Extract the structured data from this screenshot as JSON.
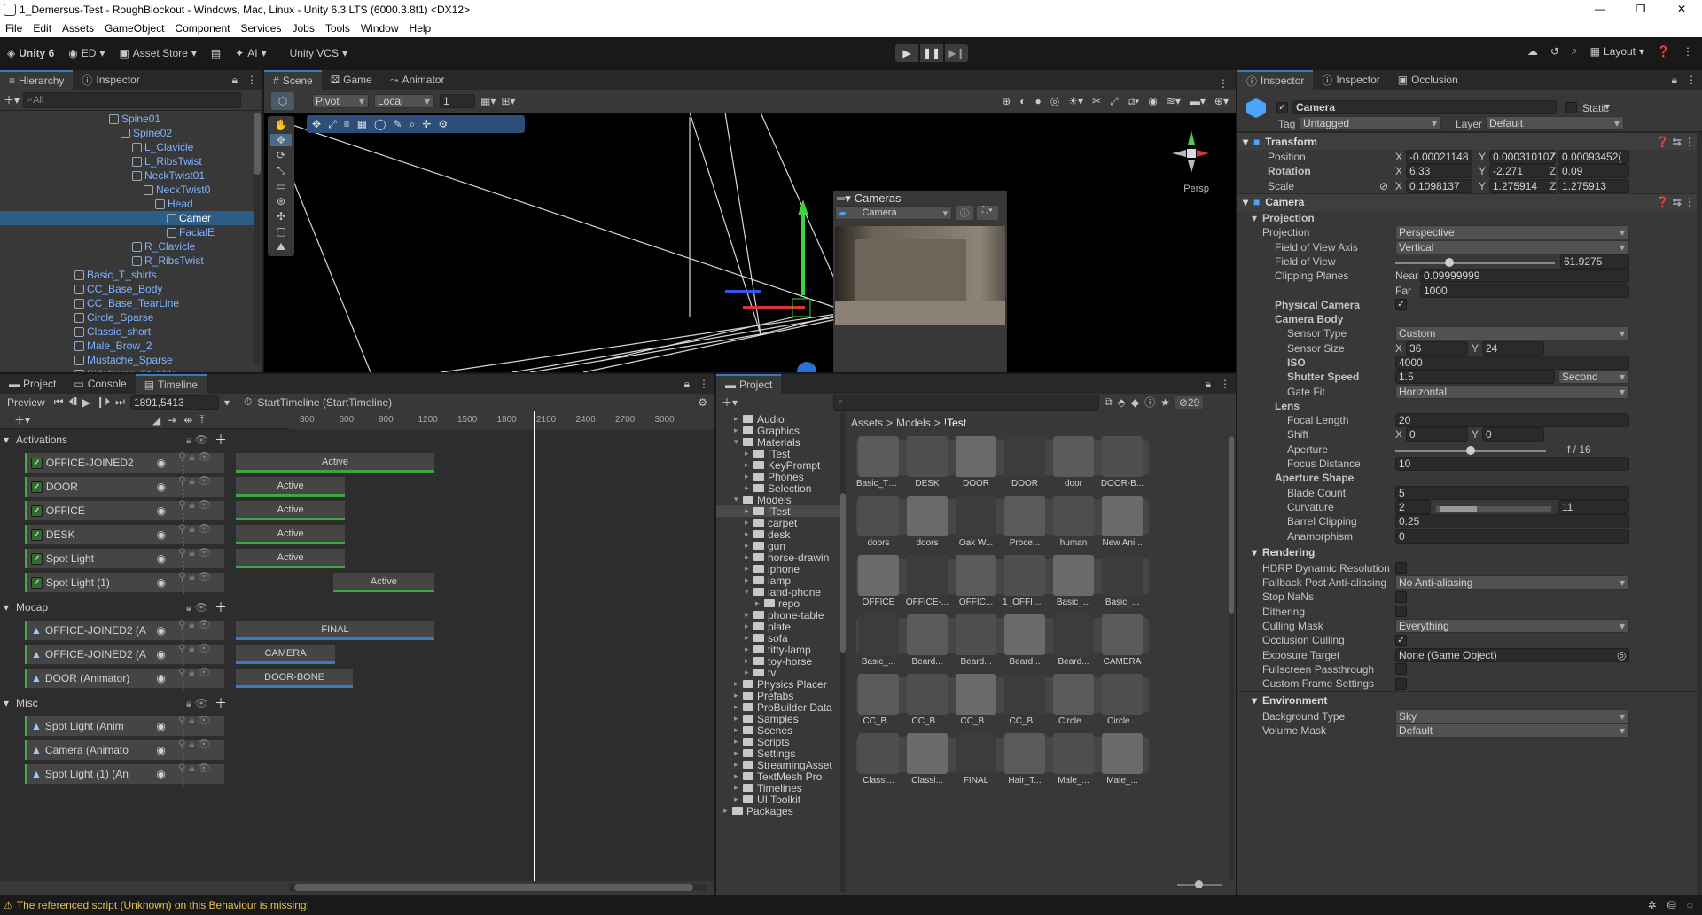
{
  "window": {
    "title": "1_Demersus-Test - RoughBlockout - Windows, Mac, Linux - Unity 6.3 LTS (6000.3.8f1) <DX12>"
  },
  "menu": [
    "File",
    "Edit",
    "Assets",
    "GameObject",
    "Component",
    "Services",
    "Jobs",
    "Tools",
    "Window",
    "Help"
  ],
  "toolbar": {
    "unity": "Unity 6",
    "account": "ED",
    "asset_store": "Asset Store",
    "ai": "AI",
    "vcs": "Unity VCS",
    "layout": "Layout"
  },
  "hierarchy": {
    "tabs": [
      "Hierarchy",
      "Inspector"
    ],
    "search_placeholder": "All",
    "rows": [
      {
        "label": "Spine01",
        "indent": 9
      },
      {
        "label": "Spine02",
        "indent": 10
      },
      {
        "label": "L_Clavicle",
        "indent": 11
      },
      {
        "label": "L_RibsTwist",
        "indent": 11
      },
      {
        "label": "NeckTwist01",
        "indent": 11
      },
      {
        "label": "NeckTwist0",
        "indent": 12
      },
      {
        "label": "Head",
        "indent": 13
      },
      {
        "label": "Camer",
        "indent": 14,
        "selected": true
      },
      {
        "label": "FacialE",
        "indent": 14
      },
      {
        "label": "R_Clavicle",
        "indent": 11
      },
      {
        "label": "R_RibsTwist",
        "indent": 11
      },
      {
        "label": "Basic_T_shirts",
        "indent": 6
      },
      {
        "label": "CC_Base_Body",
        "indent": 6
      },
      {
        "label": "CC_Base_TearLine",
        "indent": 6
      },
      {
        "label": "Circle_Sparse",
        "indent": 6
      },
      {
        "label": "Classic_short",
        "indent": 6
      },
      {
        "label": "Male_Brow_2",
        "indent": 6
      },
      {
        "label": "Mustache_Sparse",
        "indent": 6
      },
      {
        "label": "Sideburns_Stubble",
        "indent": 6
      }
    ]
  },
  "scene": {
    "tabs": [
      "Scene",
      "Game",
      "Animator"
    ],
    "pivot": "Pivot",
    "local": "Local",
    "snap": "1",
    "persp": "Persp",
    "overlay_title": "Cameras",
    "overlay_camera": "Camera"
  },
  "timeline": {
    "tabs": [
      "Project",
      "Console",
      "Timeline"
    ],
    "preview": "Preview",
    "frame": "1891,5413",
    "asset": "StartTimeline (StartTimeline)",
    "ruler": [
      "300",
      "600",
      "900",
      "1200",
      "1500",
      "1800",
      "2100",
      "2400",
      "2700",
      "3000"
    ],
    "groups": [
      {
        "name": "Activations",
        "tracks": [
          {
            "name": "OFFICE-JOINED2",
            "clip": "Active",
            "clip_start": 0,
            "clip_end": 1
          },
          {
            "name": "DOOR",
            "clip": "Active",
            "clip_start": 0,
            "clip_end": 0.55
          },
          {
            "name": "OFFICE",
            "clip": "Active",
            "clip_start": 0,
            "clip_end": 0.55
          },
          {
            "name": "DESK",
            "clip": "Active",
            "clip_start": 0,
            "clip_end": 0.55
          },
          {
            "name": "Spot Light",
            "clip": "Active",
            "clip_start": 0,
            "clip_end": 0.55
          },
          {
            "name": "Spot Light (1)",
            "clip": "Active",
            "clip_start": 0.49,
            "clip_end": 1
          }
        ]
      },
      {
        "name": "Mocap",
        "tracks": [
          {
            "name": "OFFICE-JOINED2 (A",
            "clip": "FINAL",
            "clip_start": 0,
            "clip_end": 1
          },
          {
            "name": "OFFICE-JOINED2 (A",
            "clip": "CAMERA",
            "clip_start": 0,
            "clip_end": 0.5
          },
          {
            "name": "DOOR (Animator)",
            "clip": "DOOR-BONE",
            "clip_start": 0,
            "clip_end": 0.59
          }
        ]
      },
      {
        "name": "Misc",
        "tracks": [
          {
            "name": "Spot Light (Anim"
          },
          {
            "name": "Camera (Animato"
          },
          {
            "name": "Spot Light (1) (An"
          }
        ]
      }
    ]
  },
  "project": {
    "tab": "Project",
    "breadcrumb": [
      "Assets",
      "Models",
      "!Test"
    ],
    "count": "29",
    "tree": [
      {
        "label": "Audio",
        "d": 1
      },
      {
        "label": "Graphics",
        "d": 1
      },
      {
        "label": "Materials",
        "d": 1,
        "open": true
      },
      {
        "label": "!Test",
        "d": 2
      },
      {
        "label": "KeyPrompt",
        "d": 2
      },
      {
        "label": "Phones",
        "d": 2
      },
      {
        "label": "Selection",
        "d": 2
      },
      {
        "label": "Models",
        "d": 1,
        "open": true
      },
      {
        "label": "!Test",
        "d": 2,
        "sel": true
      },
      {
        "label": "carpet",
        "d": 2
      },
      {
        "label": "desk",
        "d": 2
      },
      {
        "label": "gun",
        "d": 2
      },
      {
        "label": "horse-drawin",
        "d": 2
      },
      {
        "label": "iphone",
        "d": 2
      },
      {
        "label": "lamp",
        "d": 2
      },
      {
        "label": "land-phone",
        "d": 2,
        "open": true
      },
      {
        "label": "repo",
        "d": 3
      },
      {
        "label": "phone-table",
        "d": 2
      },
      {
        "label": "plate",
        "d": 2
      },
      {
        "label": "sofa",
        "d": 2
      },
      {
        "label": "titty-lamp",
        "d": 2
      },
      {
        "label": "toy-horse",
        "d": 2
      },
      {
        "label": "tv",
        "d": 2
      },
      {
        "label": "Physics Placer",
        "d": 1
      },
      {
        "label": "Prefabs",
        "d": 1
      },
      {
        "label": "ProBuilder Data",
        "d": 1
      },
      {
        "label": "Samples",
        "d": 1
      },
      {
        "label": "Scenes",
        "d": 1
      },
      {
        "label": "Scripts",
        "d": 1
      },
      {
        "label": "Settings",
        "d": 1
      },
      {
        "label": "StreamingAsset",
        "d": 1
      },
      {
        "label": "TextMesh Pro",
        "d": 1
      },
      {
        "label": "Timelines",
        "d": 1
      },
      {
        "label": "UI Toolkit",
        "d": 1
      },
      {
        "label": "Packages",
        "d": 0
      }
    ],
    "assets": [
      [
        "Basic_T_...",
        "DESK",
        "DOOR",
        "DOOR",
        "door",
        "DOOR-B..."
      ],
      [
        "doors",
        "doors",
        "Oak W...",
        "Proce...",
        "human",
        "New Ani..."
      ],
      [
        "OFFICE",
        "OFFICE-...",
        "OFFIC...",
        "1_OFFICE...",
        "Basic_...",
        "Basic_..."
      ],
      [
        "Basic_...",
        "Beard...",
        "Beard...",
        "Beard...",
        "Beard...",
        "CAMERA"
      ],
      [
        "CC_B...",
        "CC_B...",
        "CC_B...",
        "CC_B...",
        "Circle...",
        "Circle..."
      ],
      [
        "Classi...",
        "Classi...",
        "FINAL",
        "Hair_T...",
        "Male_...",
        "Male_..."
      ]
    ]
  },
  "inspector": {
    "tabs": [
      "Inspector",
      "Inspector",
      "Occlusion"
    ],
    "object_name": "Camera",
    "static": "Static",
    "tag_label": "Tag",
    "tag": "Untagged",
    "layer_label": "Layer",
    "layer": "Default",
    "transform": {
      "title": "Transform",
      "position": {
        "label": "Position",
        "x": "-0.00021148",
        "y": "0.000310107",
        "z": "0.00093452("
      },
      "rotation": {
        "label": "Rotation",
        "x": "6.33",
        "y": "-2.271",
        "z": "0.09"
      },
      "scale": {
        "label": "Scale",
        "x": "0.1098137",
        "y": "1.275914",
        "z": "1.275913"
      }
    },
    "camera": {
      "title": "Camera",
      "projection_header": "Projection",
      "projection": "Perspective",
      "fov_axis": "Vertical",
      "fov": "61.9275",
      "near": "0.09999999",
      "far": "1000",
      "physical_camera": "Physical Camera",
      "camera_body": "Camera Body",
      "sensor_type": "Custom",
      "sensor_x": "36",
      "sensor_y": "24",
      "iso": "4000",
      "shutter": "1.5",
      "shutter_unit": "Second",
      "gate_fit": "Horizontal",
      "lens": "Lens",
      "focal_length": "20",
      "shift_x": "0",
      "shift_y": "0",
      "aperture": "f / 16",
      "focus_distance": "10",
      "aperture_shape": "Aperture Shape",
      "blade_count": "5",
      "curvature_min": "2",
      "curvature_max": "11",
      "barrel_clipping": "0.25",
      "anamorphism": "0",
      "labels": {
        "projection": "Projection",
        "fov_axis": "Field of View Axis",
        "fov": "Field of View",
        "clipping": "Clipping Planes",
        "near": "Near",
        "far": "Far",
        "sensor_type": "Sensor Type",
        "sensor_size": "Sensor Size",
        "iso": "ISO",
        "shutter": "Shutter Speed",
        "gate_fit": "Gate Fit",
        "focal_length": "Focal Length",
        "shift": "Shift",
        "aperture": "Aperture",
        "focus_distance": "Focus Distance",
        "blade_count": "Blade Count",
        "curvature": "Curvature",
        "barrel_clipping": "Barrel Clipping",
        "anamorphism": "Anamorphism"
      }
    },
    "rendering": {
      "title": "Rendering",
      "hdrp": "HDRP Dynamic Resolution",
      "fallback": "Fallback Post Anti-aliasing",
      "fallback_val": "No Anti-aliasing",
      "stop_nans": "Stop NaNs",
      "dithering": "Dithering",
      "culling_mask": "Culling Mask",
      "culling_val": "Everything",
      "occlusion": "Occlusion Culling",
      "exposure": "Exposure Target",
      "exposure_val": "None (Game Object)",
      "fullscreen": "Fullscreen Passthrough",
      "custom_frame": "Custom Frame Settings"
    },
    "environment": {
      "title": "Environment",
      "bg_type": "Background Type",
      "bg_val": "Sky",
      "volume": "Volume Mask",
      "volume_val": "Default"
    }
  },
  "status": {
    "message": "The referenced script (Unknown) on this Behaviour is missing!"
  }
}
